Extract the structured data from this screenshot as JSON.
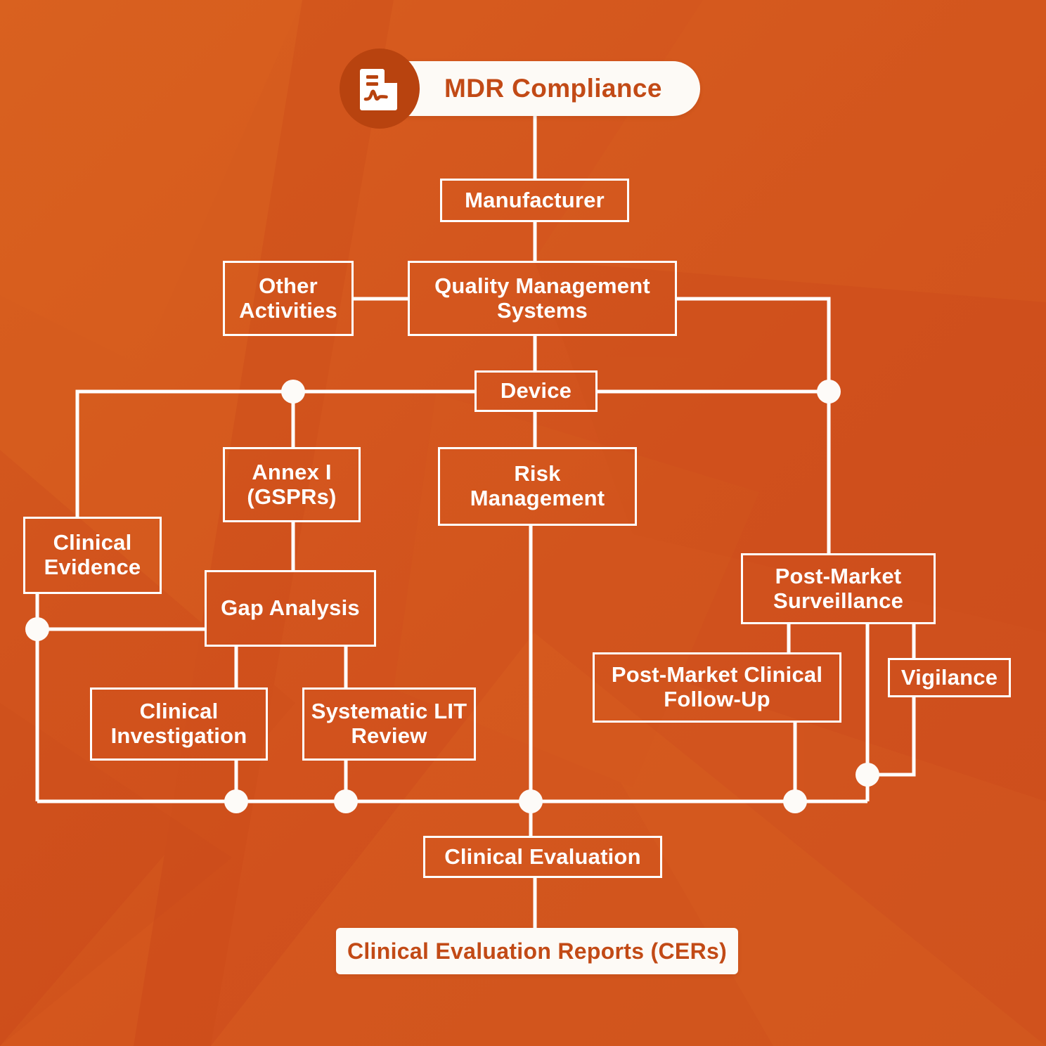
{
  "diagram": {
    "title": "MDR Compliance",
    "header": {
      "label": "MDR Compliance",
      "icon": "document-signature-icon",
      "pill_bg": "#FDFAF6",
      "pill_text_color": "#C24A16",
      "circle_color": "#B8430F"
    },
    "theme": {
      "background": "#D4551F",
      "line_color": "#FFFFFF",
      "node_text_color": "#FFFFFF",
      "accent_text_color": "#C24A16"
    },
    "nodes": [
      {
        "id": "manufacturer",
        "label": "Manufacturer",
        "style": "outline"
      },
      {
        "id": "other-activities",
        "label": "Other\nActivities",
        "style": "outline"
      },
      {
        "id": "qms",
        "label": "Quality Management\nSystems",
        "style": "outline"
      },
      {
        "id": "device",
        "label": "Device",
        "style": "outline"
      },
      {
        "id": "annex-i",
        "label": "Annex I\n(GSPRs)",
        "style": "outline"
      },
      {
        "id": "risk-management",
        "label": "Risk\nManagement",
        "style": "outline"
      },
      {
        "id": "clinical-evidence",
        "label": "Clinical\nEvidence",
        "style": "outline"
      },
      {
        "id": "gap-analysis",
        "label": "Gap Analysis",
        "style": "outline"
      },
      {
        "id": "clinical-investigation",
        "label": "Clinical\nInvestigation",
        "style": "outline"
      },
      {
        "id": "systematic-lit-review",
        "label": "Systematic LIT\nReview",
        "style": "outline"
      },
      {
        "id": "post-market-surveillance",
        "label": "Post-Market\nSurveillance",
        "style": "outline"
      },
      {
        "id": "post-market-clinical-follow-up",
        "label": "Post-Market Clinical\nFollow-Up",
        "style": "outline"
      },
      {
        "id": "vigilance",
        "label": "Vigilance",
        "style": "outline"
      },
      {
        "id": "clinical-evaluation",
        "label": "Clinical Evaluation",
        "style": "outline"
      },
      {
        "id": "cers",
        "label": "Clinical Evaluation Reports (CERs)",
        "style": "filled"
      }
    ],
    "labels": {
      "manufacturer": "Manufacturer",
      "other_activities_l1": "Other",
      "other_activities_l2": "Activities",
      "qms_l1": "Quality Management",
      "qms_l2": "Systems",
      "device": "Device",
      "annex_l1": "Annex I",
      "annex_l2": "(GSPRs)",
      "risk_l1": "Risk",
      "risk_l2": "Management",
      "clinical_evidence_l1": "Clinical",
      "clinical_evidence_l2": "Evidence",
      "gap_analysis": "Gap Analysis",
      "clinical_investigation_l1": "Clinical",
      "clinical_investigation_l2": "Investigation",
      "slr_l1": "Systematic LIT",
      "slr_l2": "Review",
      "pms_l1": "Post-Market",
      "pms_l2": "Surveillance",
      "pmcf_l1": "Post-Market Clinical",
      "pmcf_l2": "Follow-Up",
      "vigilance": "Vigilance",
      "clinical_evaluation": "Clinical Evaluation",
      "cers": "Clinical Evaluation Reports (CERs)"
    },
    "connections": [
      {
        "from": "header",
        "to": "manufacturer"
      },
      {
        "from": "manufacturer",
        "to": "qms"
      },
      {
        "from": "other-activities",
        "to": "qms"
      },
      {
        "from": "qms",
        "to": "device"
      },
      {
        "from": "qms",
        "to": "post-market-surveillance"
      },
      {
        "from": "device",
        "to": "annex-i"
      },
      {
        "from": "device",
        "to": "risk-management"
      },
      {
        "from": "device",
        "to": "clinical-evidence"
      },
      {
        "from": "annex-i",
        "to": "gap-analysis"
      },
      {
        "from": "gap-analysis",
        "to": "clinical-investigation"
      },
      {
        "from": "gap-analysis",
        "to": "systematic-lit-review"
      },
      {
        "from": "gap-analysis",
        "to": "clinical-evidence"
      },
      {
        "from": "clinical-evidence",
        "to": "clinical-evaluation"
      },
      {
        "from": "clinical-investigation",
        "to": "clinical-evaluation"
      },
      {
        "from": "systematic-lit-review",
        "to": "clinical-evaluation"
      },
      {
        "from": "risk-management",
        "to": "clinical-evaluation"
      },
      {
        "from": "post-market-surveillance",
        "to": "post-market-clinical-follow-up"
      },
      {
        "from": "post-market-surveillance",
        "to": "vigilance"
      },
      {
        "from": "post-market-clinical-follow-up",
        "to": "clinical-evaluation"
      },
      {
        "from": "vigilance",
        "to": "clinical-evaluation"
      },
      {
        "from": "clinical-evaluation",
        "to": "cers"
      }
    ],
    "junction_count": 8
  }
}
